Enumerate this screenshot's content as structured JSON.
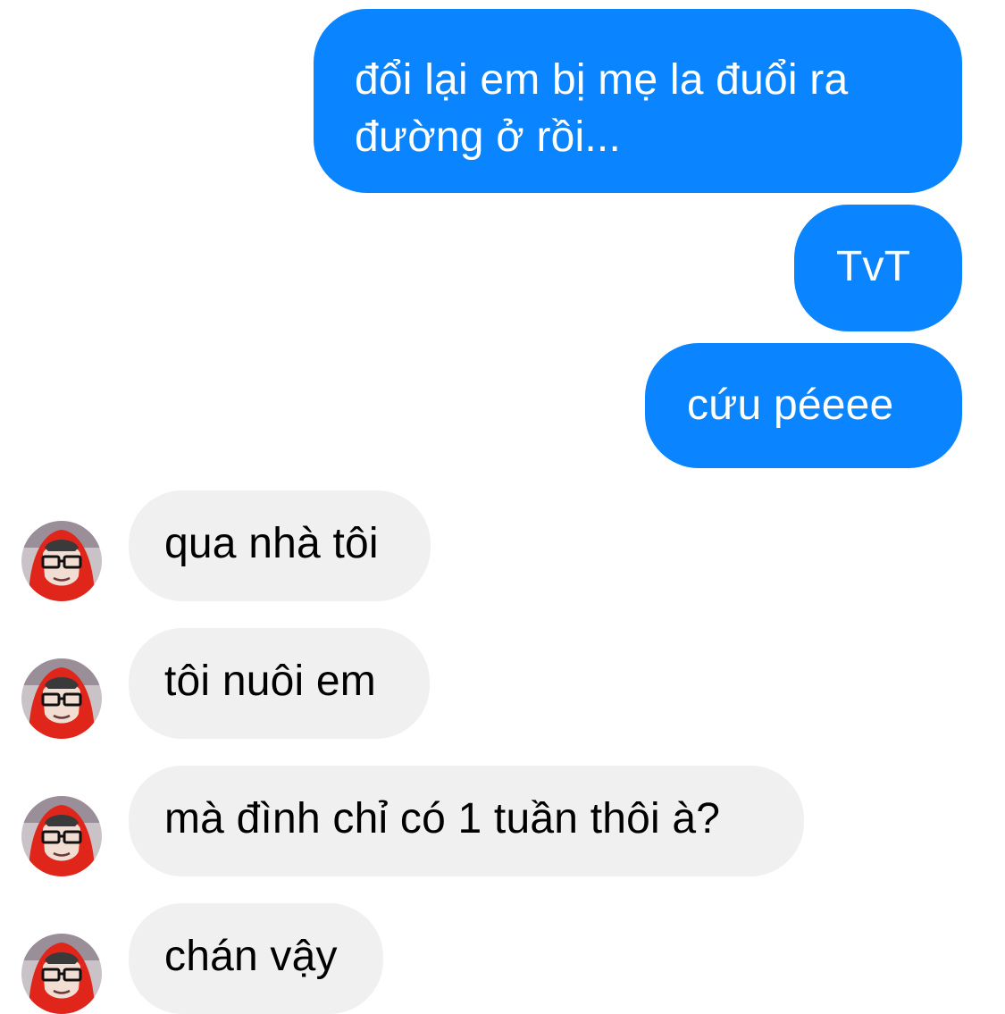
{
  "messages": [
    {
      "sender": "me",
      "lines": [
        "đổi lại em bị mẹ la đuổi ra",
        "đường ở rồi..."
      ]
    },
    {
      "sender": "me",
      "lines": [
        "TvT"
      ]
    },
    {
      "sender": "me",
      "lines": [
        "cứu péeee"
      ]
    },
    {
      "sender": "them",
      "lines": [
        "qua nhà tôi"
      ]
    },
    {
      "sender": "them",
      "lines": [
        "tôi nuôi em"
      ]
    },
    {
      "sender": "them",
      "lines": [
        "mà đình chỉ có 1 tuần thôi à?"
      ]
    },
    {
      "sender": "them",
      "lines": [
        "chán vậy"
      ]
    }
  ],
  "colors": {
    "outgoing_bubble": "#0a84ff",
    "outgoing_text": "#ffffff",
    "incoming_bubble": "#f0f0f0",
    "incoming_text": "#000000"
  },
  "icons": {
    "avatar": "avatar-icon"
  }
}
